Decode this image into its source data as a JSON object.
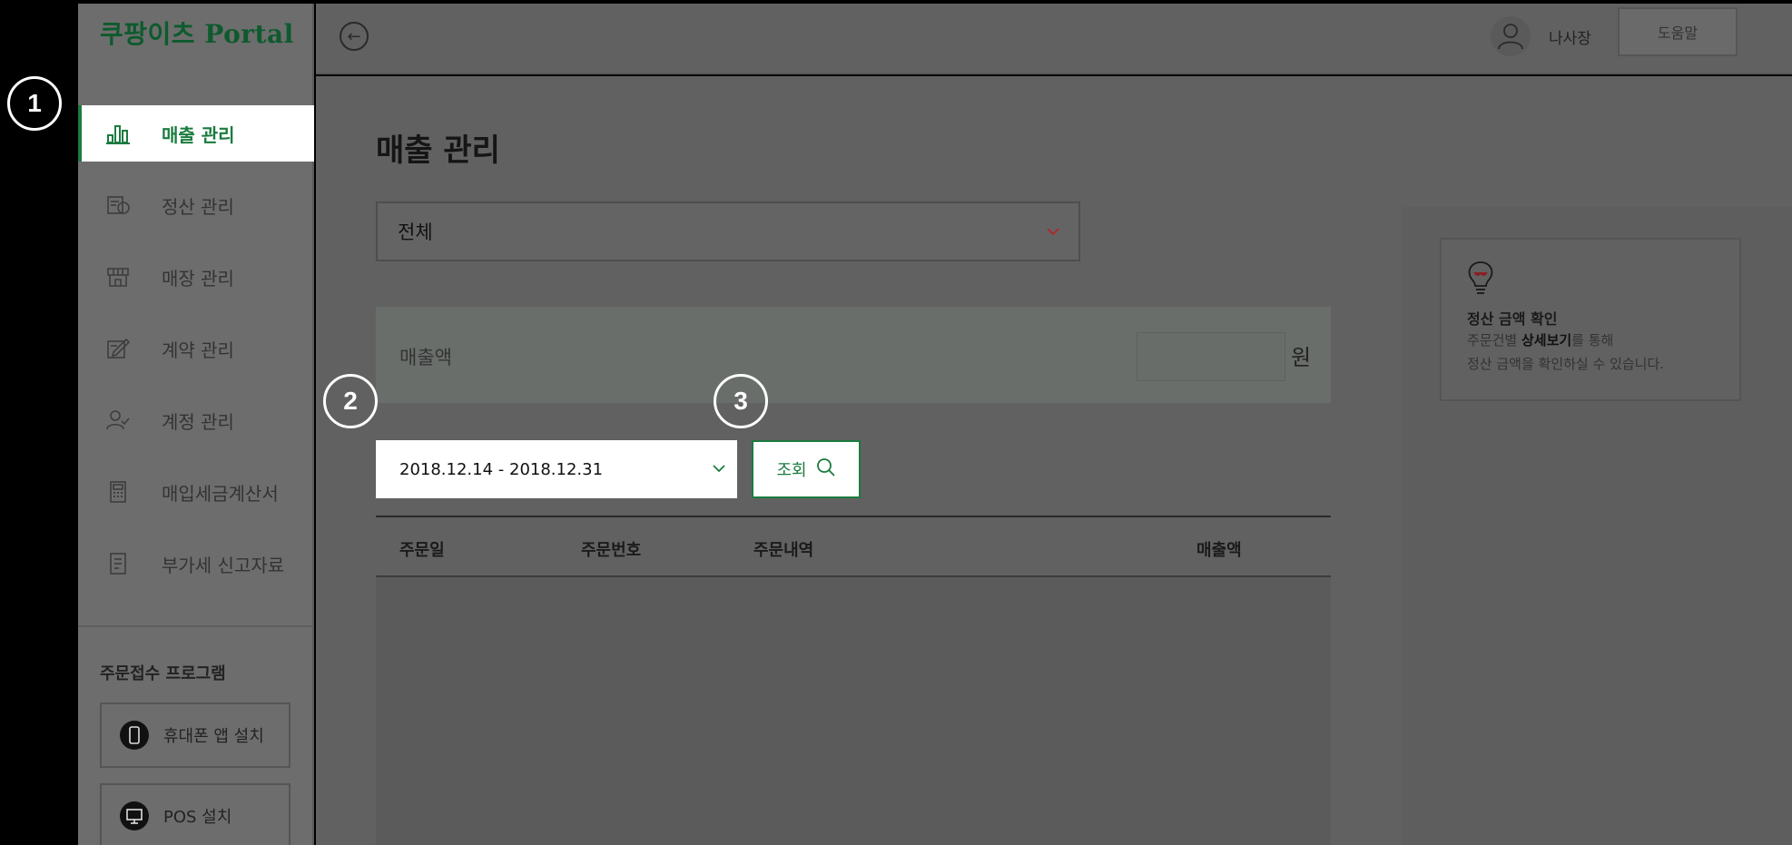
{
  "app": {
    "logo": "쿠팡이츠 Portal"
  },
  "header": {
    "user_name": "나사장",
    "help_label": "도움말"
  },
  "sidebar": {
    "items": [
      {
        "label": "매출 관리",
        "icon": "bar-chart-icon",
        "active": true
      },
      {
        "label": "정산 관리",
        "icon": "settlement-icon",
        "active": false
      },
      {
        "label": "매장 관리",
        "icon": "store-icon",
        "active": false
      },
      {
        "label": "계약 관리",
        "icon": "contract-icon",
        "active": false
      },
      {
        "label": "계정 관리",
        "icon": "account-icon",
        "active": false
      },
      {
        "label": "매입세금계산서",
        "icon": "calculator-icon",
        "active": false
      },
      {
        "label": "부가세 신고자료",
        "icon": "document-icon",
        "active": false
      }
    ],
    "program_title": "주문접수 프로그램",
    "program_buttons": [
      {
        "label": "휴대폰 앱 설치",
        "icon": "phone-icon"
      },
      {
        "label": "POS 설치",
        "icon": "monitor-icon"
      }
    ]
  },
  "main": {
    "title": "매출 관리",
    "store_select": "전체",
    "sales_label": "매출액",
    "sales_unit": "원",
    "date_range": "2018.12.14 - 2018.12.31",
    "query_label": "조회",
    "table_headers": [
      "주문일",
      "주문번호",
      "주문내역",
      "매출액"
    ]
  },
  "tip": {
    "title": "정산 금액 확인",
    "line1_prefix": "주문건별 ",
    "line1_bold": "상세보기",
    "line1_suffix": "를 통해",
    "line2": "정산 금액을 확인하실 수 있습니다."
  },
  "callouts": [
    "1",
    "2",
    "3"
  ],
  "colors": {
    "accent": "#1b7b3f",
    "chevron_red": "#b0262c"
  }
}
